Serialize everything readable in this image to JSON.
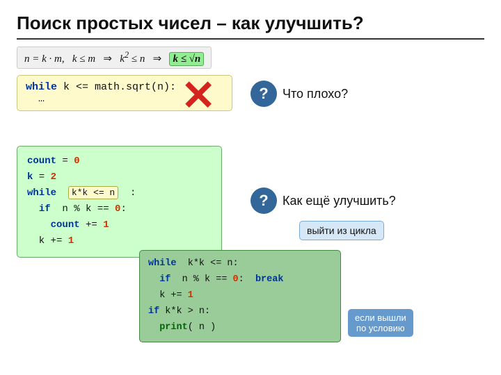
{
  "title": "Поиск простых чисел – как улучшить?",
  "formula": {
    "part1": "n = k · m,",
    "part2": "k ≤ m",
    "arrow1": "⇒",
    "part3": "k² ≤ n",
    "arrow2": "⇒",
    "highlight": "k ≤ √n"
  },
  "code_top": {
    "line1": "while k <= math.sqrt(n):",
    "line2": "  …"
  },
  "red_x": "✕",
  "question_top": {
    "label": "?",
    "text": "Что плохо?"
  },
  "code_main": {
    "line_count": "    count += 1",
    "line_k": "k = 2",
    "line_while": "while",
    "line_while_cond": "k*k <= n",
    "line_colon": ":",
    "line_if": "  if  n % k == 0:",
    "line_k2": "  k += 1"
  },
  "question_bottom": {
    "label": "?",
    "text": "Как ещё улучшить?"
  },
  "exit_note": "выйти из цикла",
  "code_bottom": {
    "line1": "while  k*k <= n:",
    "line2": "  if  n % k == 0:  break",
    "line3": "  k += 1",
    "line4": "if k*k > n:",
    "line5": "  print( n )"
  },
  "condition_note_line1": "если вышли",
  "condition_note_line2": "по условию"
}
